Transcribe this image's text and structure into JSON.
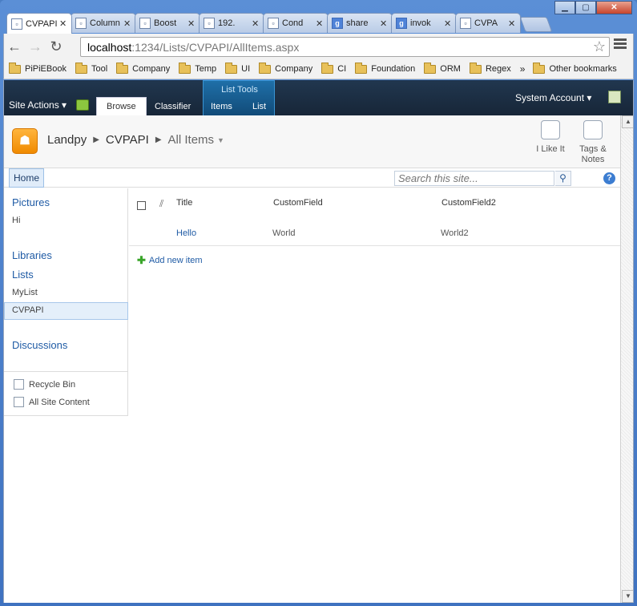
{
  "browser": {
    "tabs": [
      {
        "label": "CVPAPI",
        "icon": "page-icon",
        "active": true
      },
      {
        "label": "Column",
        "icon": "page-icon"
      },
      {
        "label": "Boost",
        "icon": "page-icon"
      },
      {
        "label": "192.",
        "icon": "page-icon"
      },
      {
        "label": "Cond",
        "icon": "page-icon"
      },
      {
        "label": "share",
        "icon": "google-icon"
      },
      {
        "label": "invok",
        "icon": "google-icon"
      },
      {
        "label": "CVPA",
        "icon": "page-icon"
      }
    ],
    "url_host": "localhost",
    "url_path": ":1234/Lists/CVPAPI/AllItems.aspx",
    "bookmarks": [
      "PiPiEBook",
      "Tool",
      "Company",
      "Temp",
      "UI",
      "Company",
      "CI",
      "Foundation",
      "ORM",
      "Regex"
    ],
    "more_bookmarks": "»",
    "other_bookmarks": "Other bookmarks"
  },
  "ribbon": {
    "site_actions": "Site Actions",
    "tabs": [
      "Browse",
      "Classifier",
      "Items",
      "List"
    ],
    "contextual_group": "List Tools",
    "account": "System Account"
  },
  "header": {
    "breadcrumb": [
      "Landpy",
      "CVPAPI",
      "All Items"
    ],
    "like_label": "I Like It",
    "tags_label_1": "Tags &",
    "tags_label_2": "Notes"
  },
  "topnav": {
    "home": "Home",
    "search_placeholder": "Search this site..."
  },
  "quicklaunch": {
    "pictures": "Pictures",
    "pictures_items": [
      "Hi"
    ],
    "libraries": "Libraries",
    "lists": "Lists",
    "list_items": [
      "MyList",
      "CVPAPI"
    ],
    "discussions": "Discussions",
    "recycle_bin": "Recycle Bin",
    "all_site_content": "All Site Content"
  },
  "list": {
    "columns": [
      "Title",
      "CustomField",
      "CustomField2"
    ],
    "rows": [
      [
        "Hello",
        "World",
        "World2"
      ]
    ],
    "add_new": "Add new item"
  }
}
